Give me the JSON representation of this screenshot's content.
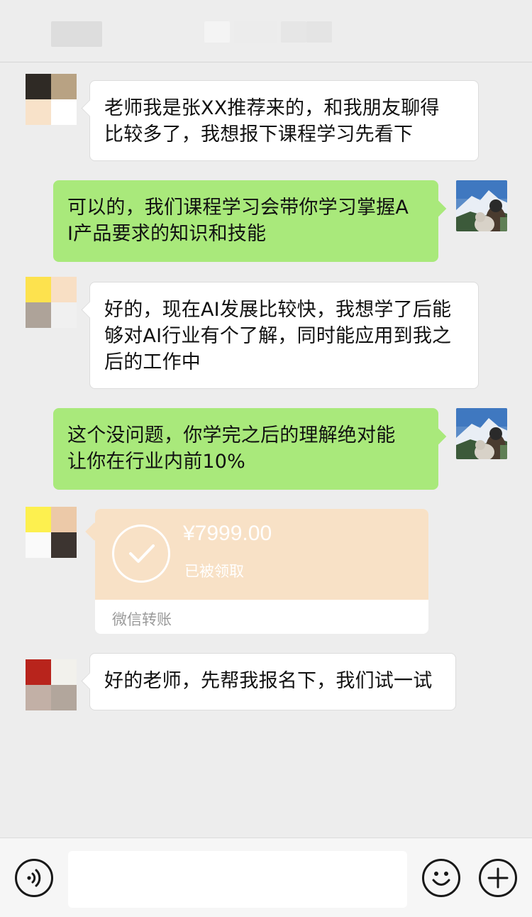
{
  "header": {
    "title": ""
  },
  "messages": [
    {
      "side": "left",
      "text": "老师我是张XX推荐来的，和我朋友聊得\n比较多了，我想报下课程学习先看下"
    },
    {
      "side": "right",
      "text": "可以的，我们课程学习会带你学习掌握A\nI产品要求的知识和技能"
    },
    {
      "side": "left",
      "text": "好的，现在AI发展比较快，我想学了后能\n够对AI行业有个了解，同时能应用到我之\n后的工作中"
    },
    {
      "side": "right",
      "text": "这个没问题，你学完之后的理解绝对能\n让你在行业内前10%"
    },
    {
      "side": "left",
      "text": "好的老师，先帮我报名下，我们试一试"
    }
  ],
  "transfer": {
    "amount": "¥7999.00",
    "status": "已被领取",
    "label": "微信转账",
    "color": "#f8e1c6"
  },
  "footer": {
    "voice_icon": "voice-icon",
    "emoji_icon": "emoji-icon",
    "plus_icon": "plus-icon",
    "input_value": ""
  },
  "colors": {
    "background": "#ededed",
    "sent_bubble": "#a9e97b",
    "received_bubble": "#ffffff"
  }
}
